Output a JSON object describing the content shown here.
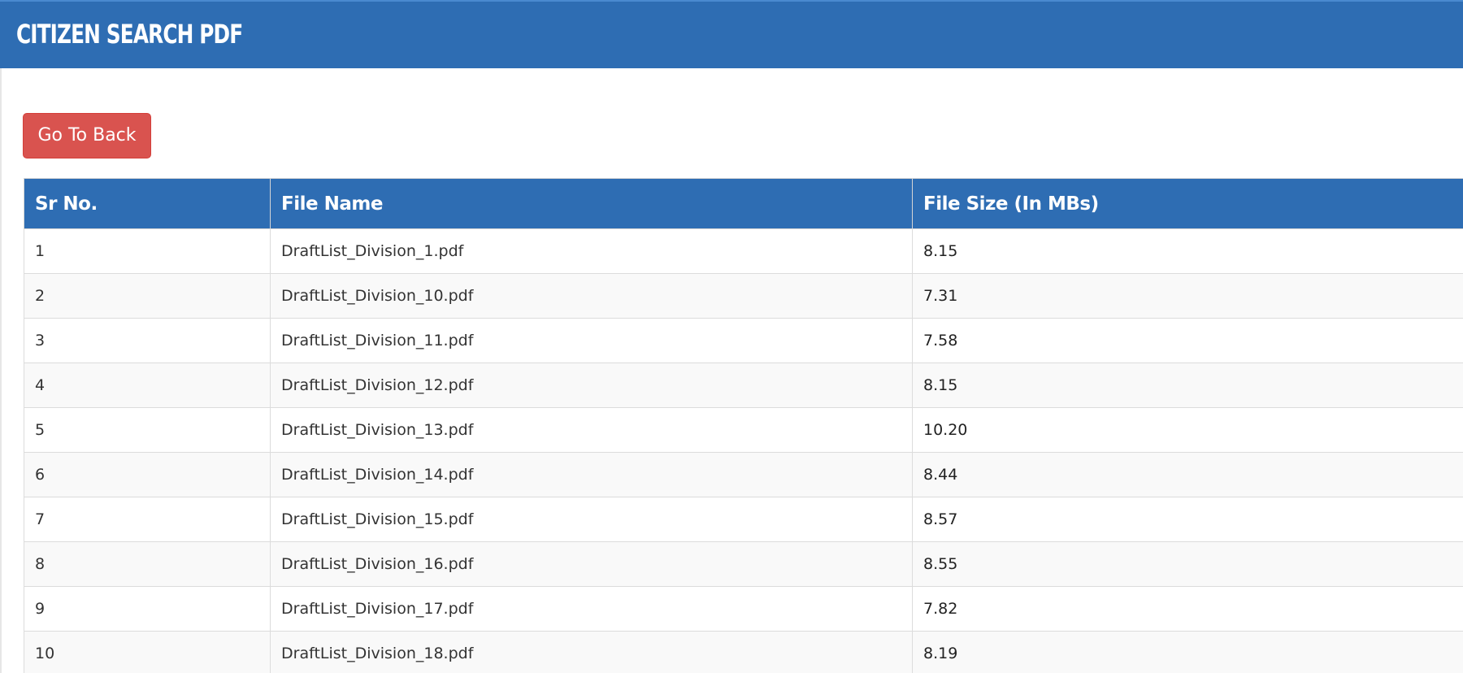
{
  "header": {
    "title": "CITIZEN SEARCH PDF"
  },
  "actions": {
    "back_label": "Go To Back"
  },
  "table": {
    "columns": [
      "Sr No.",
      "File Name",
      "File Size (In MBs)"
    ],
    "rows": [
      {
        "sr": "1",
        "file": "DraftList_Division_1.pdf",
        "size": "8.15"
      },
      {
        "sr": "2",
        "file": "DraftList_Division_10.pdf",
        "size": "7.31"
      },
      {
        "sr": "3",
        "file": "DraftList_Division_11.pdf",
        "size": "7.58"
      },
      {
        "sr": "4",
        "file": "DraftList_Division_12.pdf",
        "size": "8.15"
      },
      {
        "sr": "5",
        "file": "DraftList_Division_13.pdf",
        "size": "10.20"
      },
      {
        "sr": "6",
        "file": "DraftList_Division_14.pdf",
        "size": "8.44"
      },
      {
        "sr": "7",
        "file": "DraftList_Division_15.pdf",
        "size": "8.57"
      },
      {
        "sr": "8",
        "file": "DraftList_Division_16.pdf",
        "size": "8.55"
      },
      {
        "sr": "9",
        "file": "DraftList_Division_17.pdf",
        "size": "7.82"
      },
      {
        "sr": "10",
        "file": "DraftList_Division_18.pdf",
        "size": "8.19"
      }
    ]
  },
  "colors": {
    "header_bg": "#2e6db3",
    "button_bg": "#d9534f",
    "row_alt_bg": "#f9f9f9"
  }
}
